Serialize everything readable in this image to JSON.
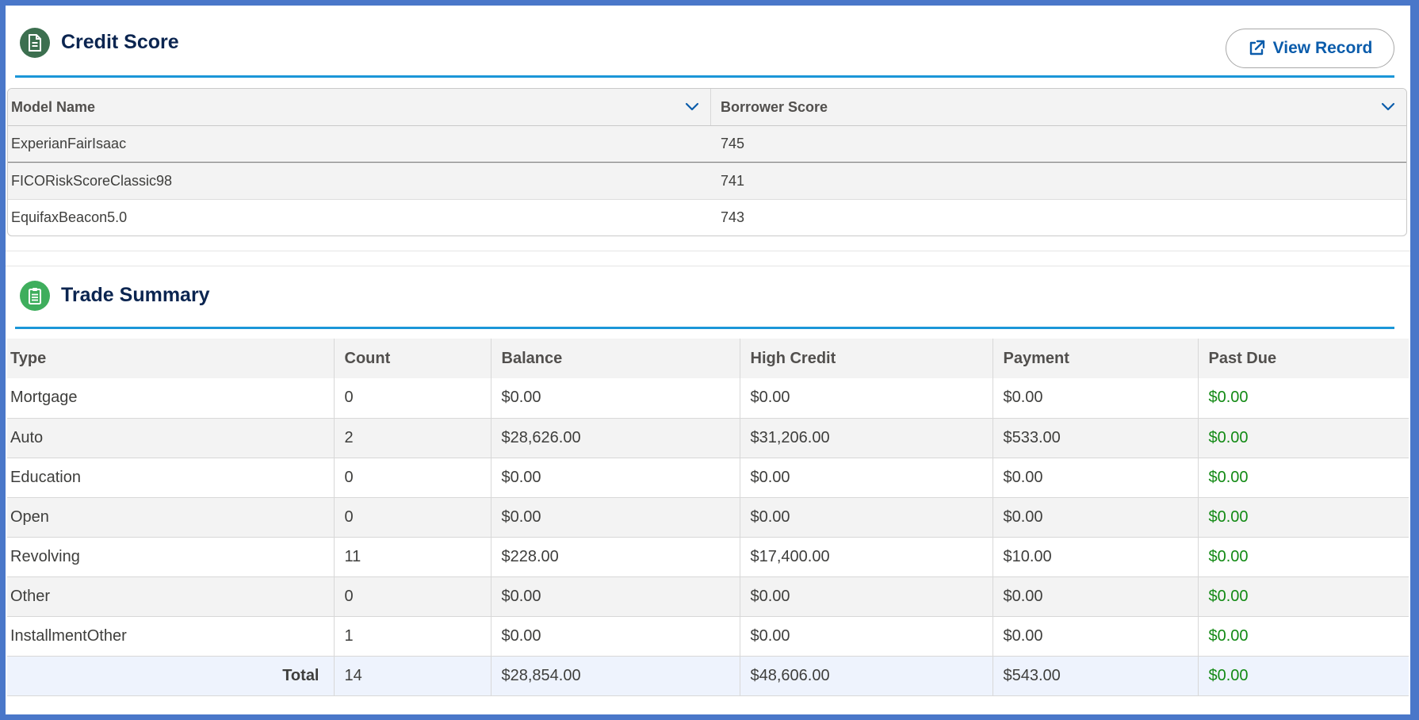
{
  "credit_score": {
    "title": "Credit Score",
    "icon": "document-icon",
    "view_record_label": "View Record",
    "columns": [
      "Model Name",
      "Borrower Score"
    ],
    "rows": [
      {
        "model": "ExperianFairIsaac",
        "score": "745"
      },
      {
        "model": "FICORiskScoreClassic98",
        "score": "741"
      },
      {
        "model": "EquifaxBeacon5.0",
        "score": "743"
      }
    ]
  },
  "trade_summary": {
    "title": "Trade Summary",
    "icon": "clipboard-icon",
    "columns": [
      "Type",
      "Count",
      "Balance",
      "High Credit",
      "Payment",
      "Past Due"
    ],
    "rows": [
      {
        "type": "Mortgage",
        "count": "0",
        "balance": "$0.00",
        "high_credit": "$0.00",
        "payment": "$0.00",
        "past_due": "$0.00"
      },
      {
        "type": "Auto",
        "count": "2",
        "balance": "$28,626.00",
        "high_credit": "$31,206.00",
        "payment": "$533.00",
        "past_due": "$0.00"
      },
      {
        "type": "Education",
        "count": "0",
        "balance": "$0.00",
        "high_credit": "$0.00",
        "payment": "$0.00",
        "past_due": "$0.00"
      },
      {
        "type": "Open",
        "count": "0",
        "balance": "$0.00",
        "high_credit": "$0.00",
        "payment": "$0.00",
        "past_due": "$0.00"
      },
      {
        "type": "Revolving",
        "count": "11",
        "balance": "$228.00",
        "high_credit": "$17,400.00",
        "payment": "$10.00",
        "past_due": "$0.00"
      },
      {
        "type": "Other",
        "count": "0",
        "balance": "$0.00",
        "high_credit": "$0.00",
        "payment": "$0.00",
        "past_due": "$0.00"
      },
      {
        "type": "InstallmentOther",
        "count": "1",
        "balance": "$0.00",
        "high_credit": "$0.00",
        "payment": "$0.00",
        "past_due": "$0.00"
      }
    ],
    "total": {
      "label": "Total",
      "count": "14",
      "balance": "$28,854.00",
      "high_credit": "$48,606.00",
      "payment": "$543.00",
      "past_due": "$0.00"
    }
  },
  "colors": {
    "frame": "#4a77c9",
    "accent_line": "#1b96d8",
    "title": "#0b2550",
    "link": "#0b5cab",
    "past_due": "#128a14"
  }
}
